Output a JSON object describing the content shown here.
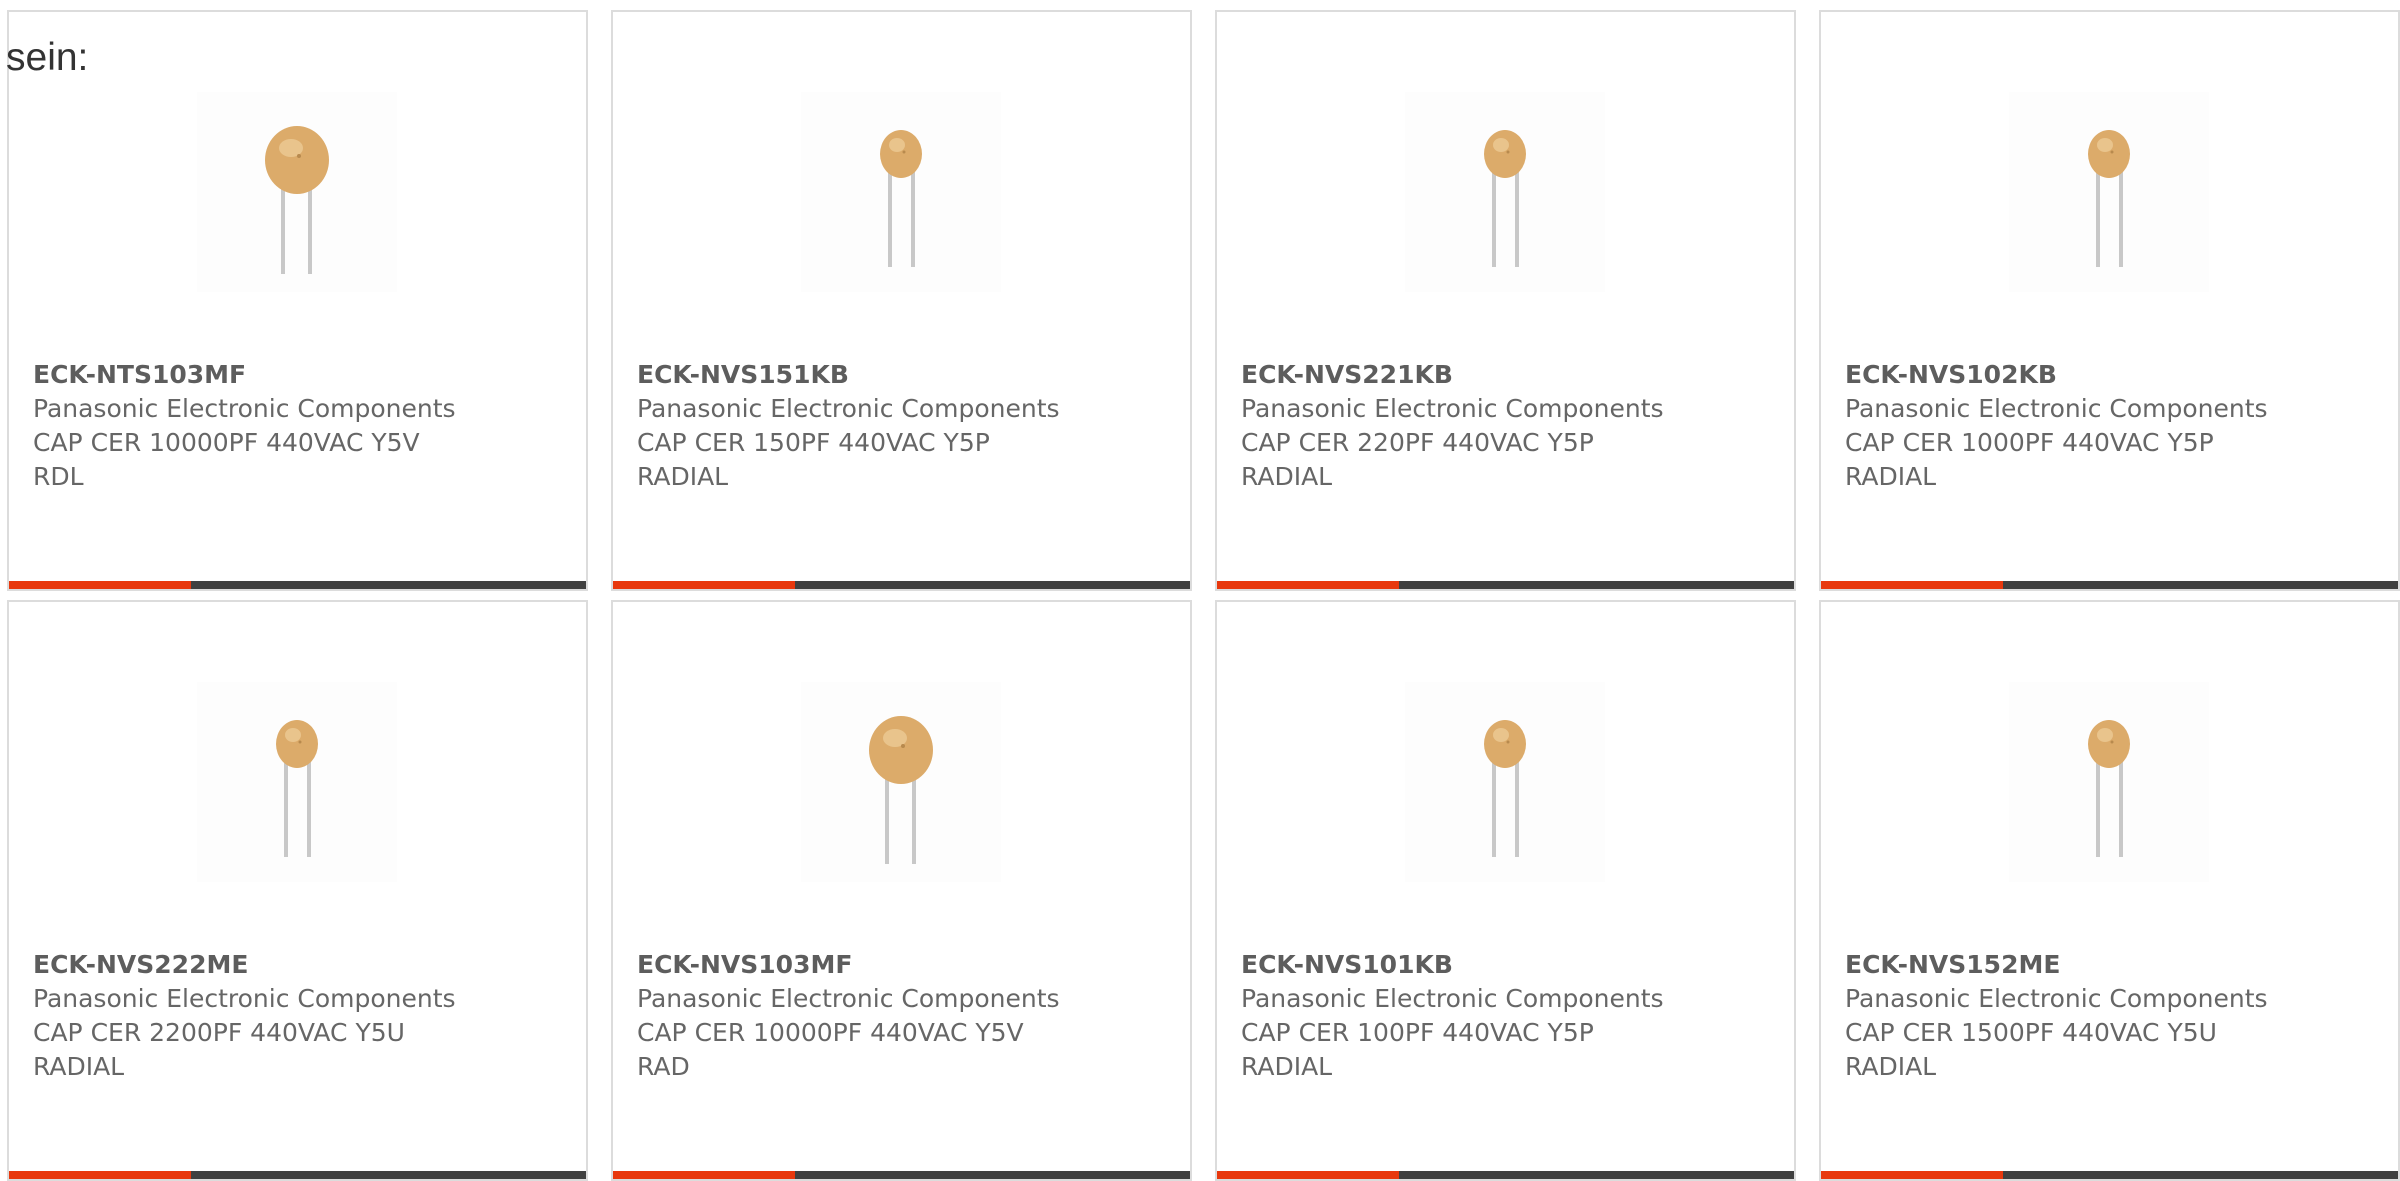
{
  "intro_text": "sein:",
  "colors": {
    "accent": "#e8380d",
    "bar_dark": "#404040",
    "text": "#666666",
    "border": "#dcdcdc"
  },
  "products": [
    {
      "part": "ECK-NTS103MF",
      "manufacturer": "Panasonic Electronic Components",
      "description": "CAP CER 10000PF 440VAC Y5V\nRDL",
      "image_icon": "ceramic-disc-capacitor-large"
    },
    {
      "part": "ECK-NVS151KB",
      "manufacturer": "Panasonic Electronic Components",
      "description": "CAP CER 150PF 440VAC Y5P\nRADIAL",
      "image_icon": "ceramic-disc-capacitor-small"
    },
    {
      "part": "ECK-NVS221KB",
      "manufacturer": "Panasonic Electronic Components",
      "description": "CAP CER 220PF 440VAC Y5P\nRADIAL",
      "image_icon": "ceramic-disc-capacitor-small"
    },
    {
      "part": "ECK-NVS102KB",
      "manufacturer": "Panasonic Electronic Components",
      "description": "CAP CER 1000PF 440VAC Y5P\nRADIAL",
      "image_icon": "ceramic-disc-capacitor-small"
    },
    {
      "part": "ECK-NVS222ME",
      "manufacturer": "Panasonic Electronic Components",
      "description": "CAP CER 2200PF 440VAC Y5U\nRADIAL",
      "image_icon": "ceramic-disc-capacitor-small"
    },
    {
      "part": "ECK-NVS103MF",
      "manufacturer": "Panasonic Electronic Components",
      "description": "CAP CER 10000PF 440VAC Y5V\nRAD",
      "image_icon": "ceramic-disc-capacitor-large"
    },
    {
      "part": "ECK-NVS101KB",
      "manufacturer": "Panasonic Electronic Components",
      "description": "CAP CER 100PF 440VAC Y5P\nRADIAL",
      "image_icon": "ceramic-disc-capacitor-small"
    },
    {
      "part": "ECK-NVS152ME",
      "manufacturer": "Panasonic Electronic Components",
      "description": "CAP CER 1500PF 440VAC Y5U\nRADIAL",
      "image_icon": "ceramic-disc-capacitor-small"
    }
  ]
}
